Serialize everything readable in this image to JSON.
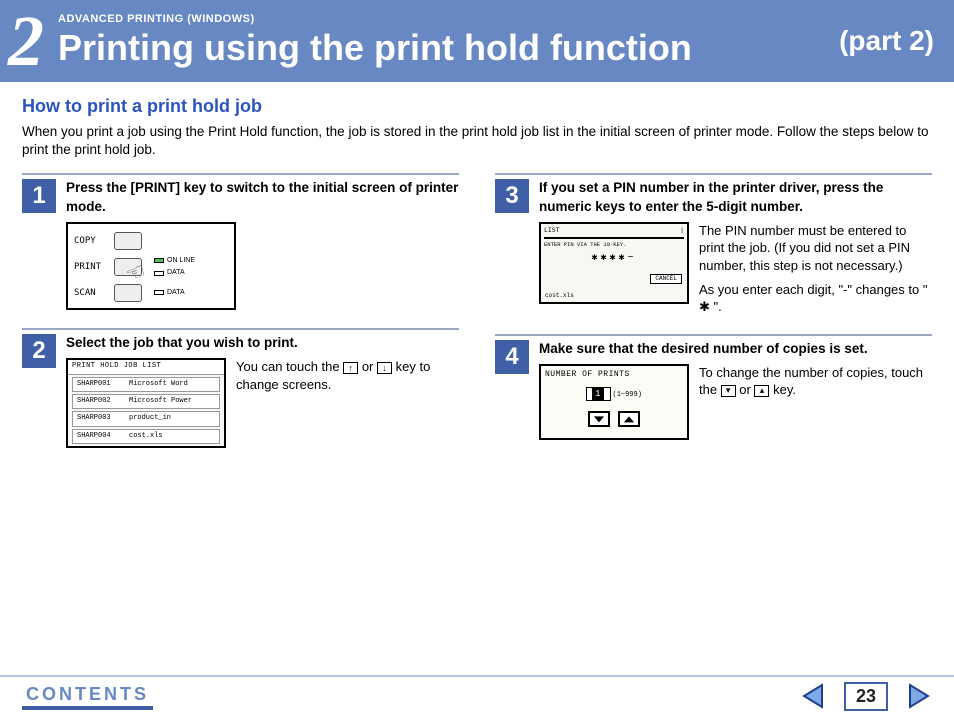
{
  "header": {
    "chapter_number": "2",
    "overline": "ADVANCED PRINTING (WINDOWS)",
    "title": "Printing using the print hold function",
    "part": "(part 2)"
  },
  "subheading": "How to print a print hold job",
  "intro": "When you print a job using the Print Hold function, the job is stored in the print hold job list in the initial screen of printer mode. Follow the steps below to print the print hold job.",
  "steps": {
    "s1": {
      "num": "1",
      "title": "Press the [PRINT] key to switch to the initial screen of printer mode.",
      "panel": {
        "labels": [
          "COPY",
          "PRINT",
          "SCAN"
        ],
        "leds": [
          "ON LINE",
          "DATA",
          "DATA"
        ]
      }
    },
    "s2": {
      "num": "2",
      "title": "Select the job that you wish to print.",
      "list_header": "PRINT HOLD JOB LIST",
      "rows": [
        {
          "id": "SHARP001",
          "name": "Microsoft Word"
        },
        {
          "id": "SHARP002",
          "name": "Microsoft Power"
        },
        {
          "id": "SHARP003",
          "name": "product_in"
        },
        {
          "id": "SHARP004",
          "name": "cost.xls"
        }
      ],
      "side_a": "You can touch the ",
      "side_b": " or ",
      "side_c": " key to change screens."
    },
    "s3": {
      "num": "3",
      "title": "If you set a PIN number in the printer driver, press the numeric keys to enter the 5-digit number.",
      "panel": {
        "top": "LIST",
        "msg": "ENTER PIN VIA THE 10-KEY.",
        "pin": "✱✱✱✱−",
        "cancel": "CANCEL",
        "file": "cost.xls"
      },
      "side1": "The PIN number must be entered to print the job. (If you did not set a PIN number, this step is not necessary.)",
      "side2": "As you enter each digit, \"-\" changes to \" ✱ \"."
    },
    "s4": {
      "num": "4",
      "title": "Make sure that the desired number of copies is set.",
      "panel": {
        "title": "NUMBER OF PRINTS",
        "value": "1",
        "range": "(1~999)"
      },
      "side_a": "To change the number of copies, touch the ",
      "side_b": " or ",
      "side_c": " key."
    }
  },
  "footer": {
    "contents": "CONTENTS",
    "page": "23"
  }
}
